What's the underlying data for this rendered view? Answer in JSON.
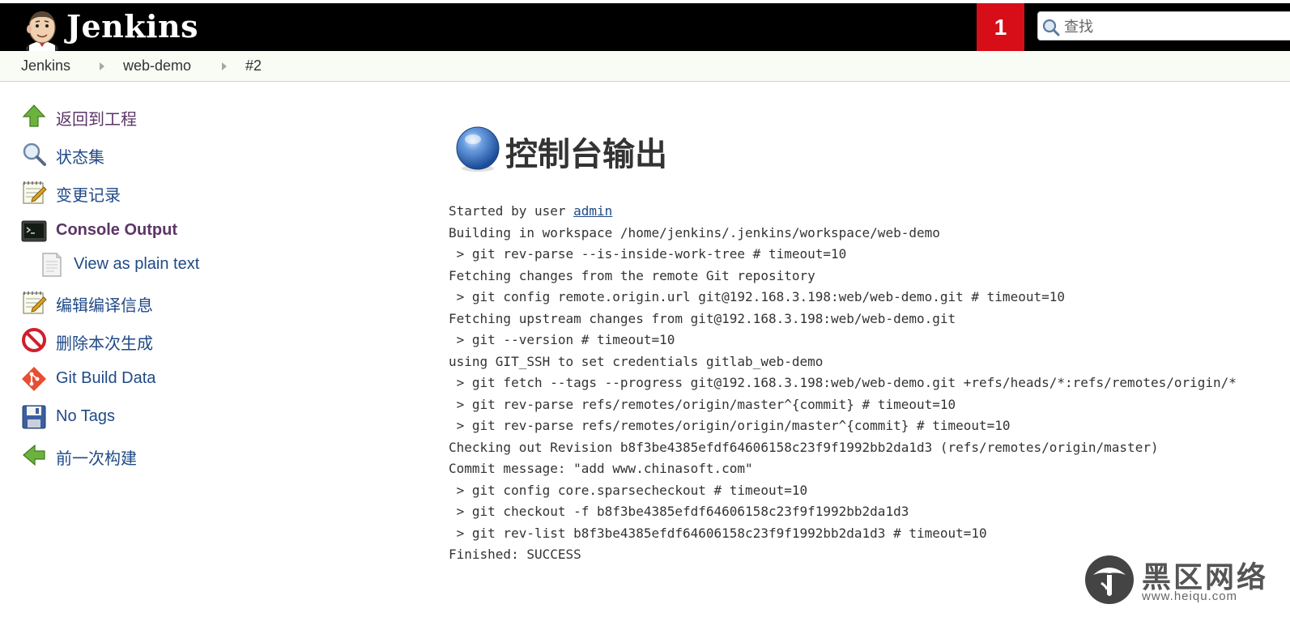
{
  "header": {
    "logo_text": "Jenkins",
    "badge_count": "1",
    "search": {
      "placeholder": "查找",
      "value": ""
    },
    "colors": {
      "bar": "#000000",
      "badge": "#d70e17"
    }
  },
  "breadcrumb": {
    "items": [
      {
        "label": "Jenkins"
      },
      {
        "label": "web-demo"
      },
      {
        "label": "#2"
      }
    ]
  },
  "sidebar": {
    "items": [
      {
        "label": "返回到工程",
        "icon": "up-arrow-icon"
      },
      {
        "label": "状态集",
        "icon": "magnifier-icon"
      },
      {
        "label": "变更记录",
        "icon": "notepad-icon"
      },
      {
        "label": "Console Output",
        "icon": "terminal-icon"
      },
      {
        "label": "View as plain text",
        "icon": "document-icon"
      },
      {
        "label": "编辑编译信息",
        "icon": "notepad-icon"
      },
      {
        "label": "删除本次生成",
        "icon": "no-entry-icon"
      },
      {
        "label": "Git Build Data",
        "icon": "git-icon"
      },
      {
        "label": "No Tags",
        "icon": "floppy-disk-icon"
      },
      {
        "label": "前一次构建",
        "icon": "left-arrow-icon"
      }
    ]
  },
  "main": {
    "title": "控制台输出",
    "console": {
      "started_prefix": "Started by user ",
      "started_user": "admin",
      "lines": [
        "Building in workspace /home/jenkins/.jenkins/workspace/web-demo",
        " > git rev-parse --is-inside-work-tree # timeout=10",
        "Fetching changes from the remote Git repository",
        " > git config remote.origin.url git@192.168.3.198:web/web-demo.git # timeout=10",
        "Fetching upstream changes from git@192.168.3.198:web/web-demo.git",
        " > git --version # timeout=10",
        "using GIT_SSH to set credentials gitlab_web-demo",
        " > git fetch --tags --progress git@192.168.3.198:web/web-demo.git +refs/heads/*:refs/remotes/origin/*",
        " > git rev-parse refs/remotes/origin/master^{commit} # timeout=10",
        " > git rev-parse refs/remotes/origin/origin/master^{commit} # timeout=10",
        "Checking out Revision b8f3be4385efdf64606158c23f9f1992bb2da1d3 (refs/remotes/origin/master)",
        "Commit message: \"add www.chinasoft.com\"",
        " > git config core.sparsecheckout # timeout=10",
        " > git checkout -f b8f3be4385efdf64606158c23f9f1992bb2da1d3",
        " > git rev-list b8f3be4385efdf64606158c23f9f1992bb2da1d3 # timeout=10",
        "Finished: SUCCESS"
      ]
    }
  },
  "watermark": {
    "title": "黑区网络",
    "url": "www.heiqu.com"
  }
}
